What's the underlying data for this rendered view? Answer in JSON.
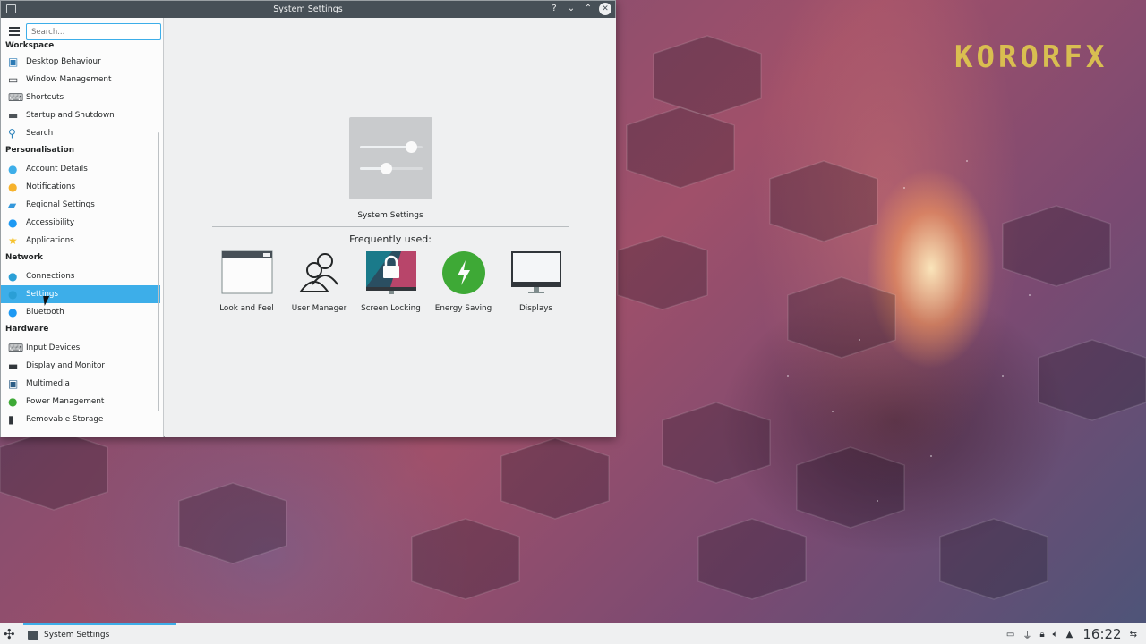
{
  "window": {
    "title": "System Settings",
    "help_label": "?",
    "min_label": "⌄",
    "max_label": "⌃",
    "close_label": "✕"
  },
  "sidebar": {
    "search_placeholder": "Search...",
    "categories": [
      {
        "label": "Workspace",
        "items": [
          {
            "label": "Desktop Behaviour",
            "icon": "desktop-icon",
            "color": "#2c7ab5"
          },
          {
            "label": "Window Management",
            "icon": "window-icon",
            "color": "#31363b"
          },
          {
            "label": "Shortcuts",
            "icon": "keyboard-icon",
            "color": "#4d5358"
          },
          {
            "label": "Startup and Shutdown",
            "icon": "monitor-icon",
            "color": "#4d5358"
          },
          {
            "label": "Search",
            "icon": "search-icon",
            "color": "#2980b9"
          }
        ]
      },
      {
        "label": "Personalisation",
        "items": [
          {
            "label": "Account Details",
            "icon": "user-icon",
            "color": "#3daee9"
          },
          {
            "label": "Notifications",
            "icon": "bell-icon",
            "color": "#f6b22c"
          },
          {
            "label": "Regional Settings",
            "icon": "flag-icon",
            "color": "#3498db"
          },
          {
            "label": "Accessibility",
            "icon": "accessibility-icon",
            "color": "#1d99f3"
          },
          {
            "label": "Applications",
            "icon": "star-icon",
            "color": "#f6c22c"
          }
        ]
      },
      {
        "label": "Network",
        "items": [
          {
            "label": "Connections",
            "icon": "globe-icon",
            "color": "#2a9fd6"
          },
          {
            "label": "Settings",
            "icon": "globe-icon",
            "color": "#2a9fd6",
            "selected": true
          },
          {
            "label": "Bluetooth",
            "icon": "bluetooth-icon",
            "color": "#1d99f3"
          }
        ]
      },
      {
        "label": "Hardware",
        "items": [
          {
            "label": "Input Devices",
            "icon": "keyboard-icon",
            "color": "#4d5358"
          },
          {
            "label": "Display and Monitor",
            "icon": "monitor-icon",
            "color": "#31363b"
          },
          {
            "label": "Multimedia",
            "icon": "multimedia-icon",
            "color": "#2c5d85"
          },
          {
            "label": "Power Management",
            "icon": "battery-icon",
            "color": "#3ea936"
          },
          {
            "label": "Removable Storage",
            "icon": "usb-icon",
            "color": "#31363b"
          }
        ]
      }
    ]
  },
  "main": {
    "header_label": "System Settings",
    "frequent_heading": "Frequently used:",
    "tiles": [
      {
        "label": "Look and Feel",
        "icon": "look-and-feel-icon"
      },
      {
        "label": "User Manager",
        "icon": "user-manager-icon"
      },
      {
        "label": "Screen Locking",
        "icon": "screen-lock-icon"
      },
      {
        "label": "Energy Saving",
        "icon": "energy-icon",
        "color": "#3ea936"
      },
      {
        "label": "Displays",
        "icon": "display-icon"
      }
    ]
  },
  "wallpaper": {
    "logo_text": "KORORFX"
  },
  "taskbar": {
    "task_label": "System Settings",
    "clock": "16:22",
    "accent": "#3daee9"
  }
}
